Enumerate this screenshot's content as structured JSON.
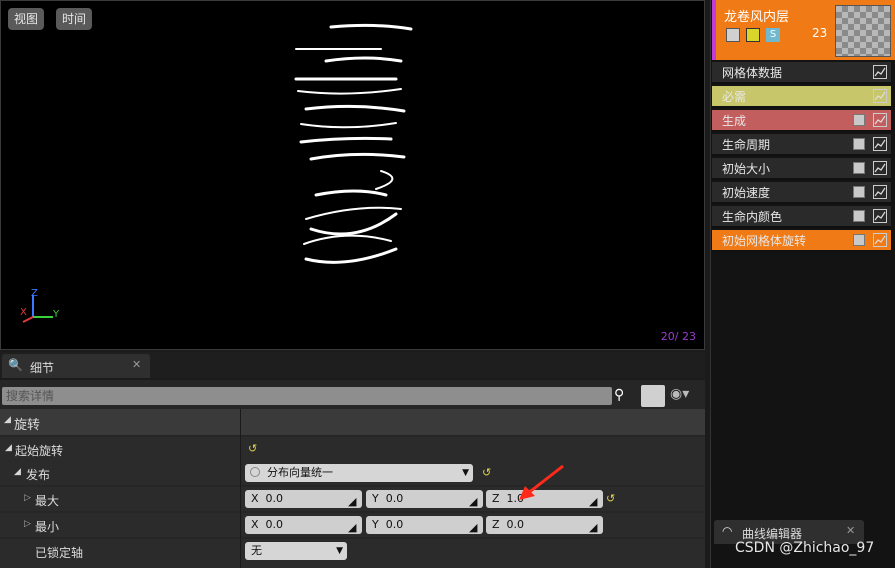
{
  "viewport": {
    "btn_view": "视图",
    "btn_time": "时间",
    "counter": "20/  23",
    "axis_x": "X",
    "axis_y": "Y",
    "axis_z": "Z"
  },
  "emitter": {
    "name": "龙卷风内层",
    "count": "23",
    "header_color": "#f07a16",
    "accent_color": "#c13bd6",
    "badge_s": "S",
    "modules": [
      {
        "label": "网格体数据",
        "color": "#2a2a2a",
        "checkbox": false
      },
      {
        "label": "必需",
        "color": "#c8c66a",
        "checkbox": false
      },
      {
        "label": "生成",
        "color": "#c25e5e",
        "checkbox": true
      },
      {
        "label": "生命周期",
        "color": "#2a2a2a",
        "checkbox": true
      },
      {
        "label": "初始大小",
        "color": "#2a2a2a",
        "checkbox": true
      },
      {
        "label": "初始速度",
        "color": "#2a2a2a",
        "checkbox": true
      },
      {
        "label": "生命内颜色",
        "color": "#2a2a2a",
        "checkbox": true
      },
      {
        "label": "初始网格体旋转",
        "color": "#f07a16",
        "checkbox": true
      }
    ]
  },
  "details": {
    "tab_label": "细节",
    "search_placeholder": "搜索详情",
    "category": "旋转",
    "start_rotation": "起始旋转",
    "distribution": "发布",
    "distribution_value": "分布向量统一",
    "max_label": "最大",
    "min_label": "最小",
    "locked_axis_label": "已锁定轴",
    "locked_axis_value": "无",
    "max": {
      "x": "0.0",
      "y": "0.0",
      "z": "1.0"
    },
    "min": {
      "x": "0.0",
      "y": "0.0",
      "z": "0.0"
    },
    "field_x": "X",
    "field_y": "Y",
    "field_z": "Z"
  },
  "curve_editor": {
    "tab_label": "曲线编辑器"
  },
  "watermark": "CSDN @Zhichao_97"
}
